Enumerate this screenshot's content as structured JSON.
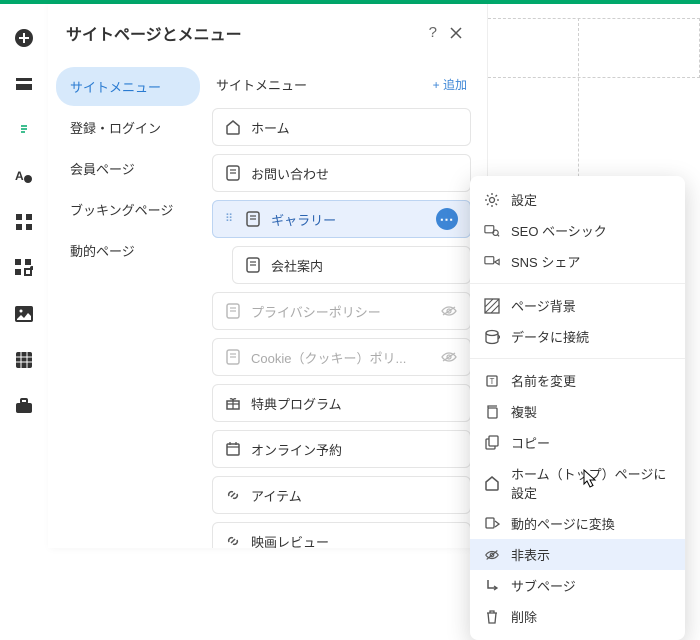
{
  "header": {
    "title": "サイトページとメニュー"
  },
  "sidenav": {
    "items": [
      {
        "label": "サイトメニュー",
        "active": true
      },
      {
        "label": "登録・ログイン"
      },
      {
        "label": "会員ページ"
      },
      {
        "label": "ブッキングページ"
      },
      {
        "label": "動的ページ"
      }
    ]
  },
  "content": {
    "title": "サイトメニュー",
    "add_label": "+ 追加",
    "items": [
      {
        "icon": "home",
        "label": "ホーム"
      },
      {
        "icon": "page",
        "label": "お問い合わせ"
      },
      {
        "icon": "page",
        "label": "ギャラリー",
        "selected": true
      },
      {
        "icon": "page",
        "label": "会社案内",
        "indent": true
      },
      {
        "icon": "page",
        "label": "プライバシーポリシー",
        "dim": true,
        "eye": true
      },
      {
        "icon": "page",
        "label": "Cookie（クッキー）ポリ...",
        "dim": true,
        "eye": true
      },
      {
        "icon": "gift",
        "label": "特典プログラム"
      },
      {
        "icon": "calendar",
        "label": "オンライン予約"
      },
      {
        "icon": "link",
        "label": "アイテム"
      },
      {
        "icon": "link",
        "label": "映画レビュー"
      }
    ]
  },
  "contextmenu": {
    "groups": [
      [
        {
          "icon": "gear",
          "label": "設定"
        },
        {
          "icon": "seo",
          "label": "SEO ベーシック"
        },
        {
          "icon": "share",
          "label": "SNS シェア"
        }
      ],
      [
        {
          "icon": "bg",
          "label": "ページ背景"
        },
        {
          "icon": "data",
          "label": "データに接続"
        }
      ],
      [
        {
          "icon": "rename",
          "label": "名前を変更"
        },
        {
          "icon": "copy",
          "label": "複製"
        },
        {
          "icon": "copy2",
          "label": "コピー"
        },
        {
          "icon": "home",
          "label": "ホーム（トップ）ページに設定"
        },
        {
          "icon": "dynamic",
          "label": "動的ページに変換"
        },
        {
          "icon": "hide",
          "label": "非表示",
          "hover": true
        },
        {
          "icon": "subpage",
          "label": "サブページ"
        },
        {
          "icon": "trash",
          "label": "削除"
        }
      ]
    ]
  },
  "iconbar": {
    "items": [
      {
        "name": "add-icon"
      },
      {
        "name": "layers-icon"
      },
      {
        "name": "pages-icon",
        "active": true
      },
      {
        "name": "design-icon"
      },
      {
        "name": "apps-icon"
      },
      {
        "name": "addons-icon"
      },
      {
        "name": "media-icon"
      },
      {
        "name": "data-icon"
      },
      {
        "name": "store-icon"
      }
    ]
  }
}
